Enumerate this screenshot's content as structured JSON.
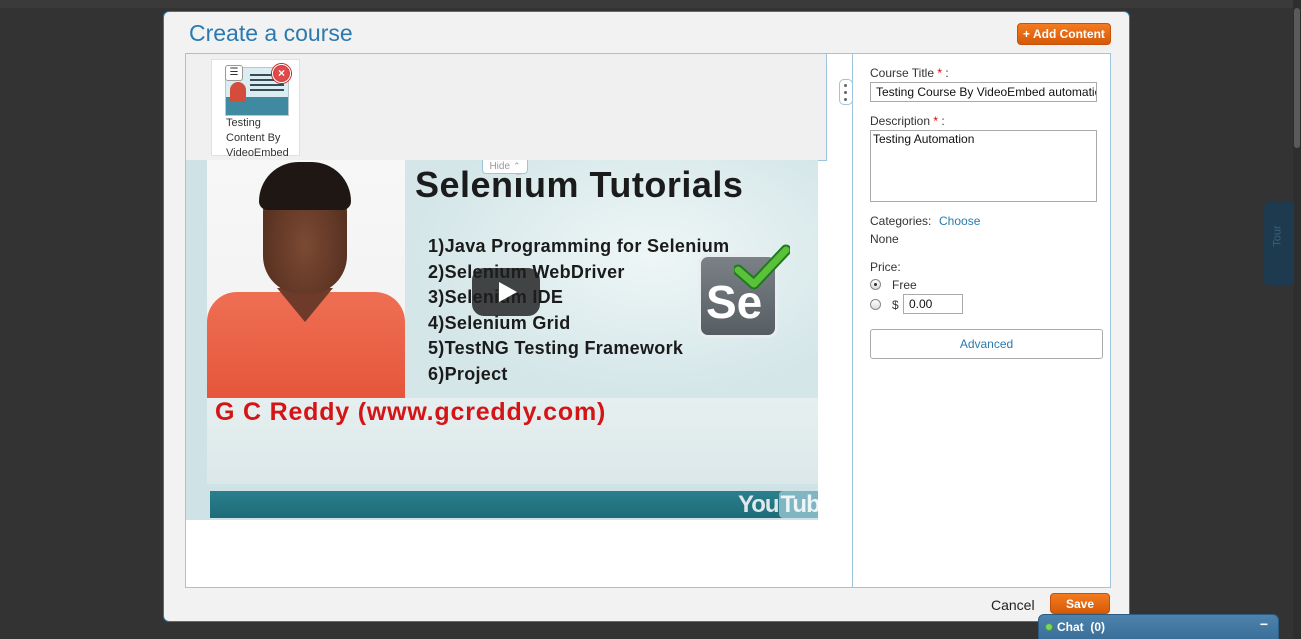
{
  "dialog": {
    "title": "Create a course",
    "add_content_label": "+ Add Content",
    "cancel_label": "Cancel",
    "save_label": "Save"
  },
  "tray": {
    "items": [
      {
        "label": "Testing Content By VideoEmbed",
        "menu_icon": "menu-icon",
        "remove_icon": "remove-icon"
      }
    ],
    "hide_label": "Hide",
    "hide_icon": "double-chevron-up-icon"
  },
  "video": {
    "slide_title": "Selenium Tutorials",
    "slide_items": [
      "1)Java Programming for Selenium",
      "2)Selenium WebDriver",
      "3)Selenium IDE",
      "4)Selenium Grid",
      "5)TestNG Testing Framework",
      "6)Project"
    ],
    "logo_text": "Se",
    "slide_subtitle": "G C Reddy (www.gcreddy.com)",
    "youtube_you": "You",
    "youtube_tube": "Tube"
  },
  "form": {
    "course_title_label": "Course Title",
    "course_title_value": "Testing Course By VideoEmbed automation",
    "description_label": "Description",
    "description_value": "Testing Automation",
    "required_mark": "*",
    "colon": " :",
    "categories_label": "Categories:",
    "categories_link": "Choose",
    "categories_value": "None",
    "price_label": "Price:",
    "price_free_label": "Free",
    "price_currency": "$",
    "price_value": "0.00",
    "price_selected": "free",
    "advanced_label": "Advanced"
  },
  "side_tab": {
    "label": "Tour"
  },
  "chat": {
    "label": "Chat",
    "count": "(0)",
    "minimize_glyph": "−"
  },
  "colors": {
    "accent": "#2a7ab0",
    "button_orange": "#e8690f",
    "chat_blue": "#3f74a0"
  }
}
